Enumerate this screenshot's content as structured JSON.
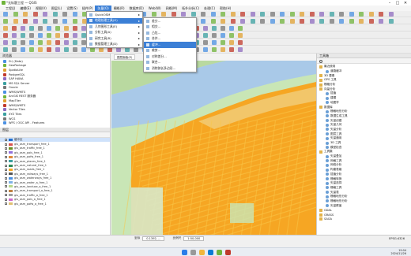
{
  "window": {
    "title": "*无标题工程 — QGIS",
    "controls": [
      "–",
      "□",
      "✕"
    ]
  },
  "menubar": {
    "items": [
      "工程(J)",
      "编辑(E)",
      "视图(V)",
      "图层(L)",
      "设置(S)",
      "插件(P)",
      "矢量(O)",
      "栅格(R)",
      "数据库(D)",
      "Web(W)",
      "网格(M)",
      "拓扑分析(C)",
      "处理(C)",
      "帮助(H)"
    ],
    "active_index": 6
  },
  "vector_menu": {
    "items": [
      {
        "label": "QuickOSM",
        "arrow": true
      },
      {
        "label": "地理处理工具(G)",
        "arrow": true,
        "highlighted": true
      },
      {
        "label": "几何图形工具(E)",
        "arrow": true
      },
      {
        "label": "分析工具(A)",
        "arrow": true
      },
      {
        "label": "研究工具(R)",
        "arrow": true
      },
      {
        "label": "数据管理工具(D)",
        "arrow": true
      }
    ]
  },
  "geoprocessing_submenu": {
    "items": [
      {
        "label": "差分...",
        "highlighted": false
      },
      {
        "label": "相交...",
        "highlighted": false
      },
      {
        "label": "凸包...",
        "highlighted": false
      },
      {
        "label": "合并...",
        "highlighted": false
      },
      {
        "label": "缓冲...",
        "highlighted": true
      },
      {
        "label": "裁剪...",
        "highlighted": false
      },
      {
        "label": "对称差分...",
        "highlighted": false
      },
      {
        "label": "联合...",
        "highlighted": false
      },
      {
        "label": "消除狭长多边形...",
        "highlighted": false
      }
    ]
  },
  "browser": {
    "title": "浏览器",
    "items": [
      "D:\\ (Data)",
      "GeoPackage",
      "SpatiaLite",
      "PostgreSQL",
      "SAP HANA",
      "MS SQL Server",
      "Oracle",
      "WMS/WMTS",
      "ArcGIS REST 服务器",
      "MapTiler",
      "WMS/WMTS",
      "Vector Tiles",
      "XYZ Tiles",
      "WCS",
      "WFS / OGC API - Features"
    ]
  },
  "layers": {
    "title": "图层",
    "items": [
      {
        "label": "缓冲区",
        "color": "#1f6fd1",
        "selected": true
      },
      {
        "label": "gis_osm_transport_free_1",
        "color": "#d9534f"
      },
      {
        "label": "gis_osm_traffic_free_1",
        "color": "#6b8e23"
      },
      {
        "label": "gis_osm_pois_free_1",
        "color": "#9370db"
      },
      {
        "label": "gis_osm_pofw_free_1",
        "color": "#e08a3c"
      },
      {
        "label": "gis_osm_places_free_1",
        "color": "#3aa0a0"
      },
      {
        "label": "gis_osm_natural_free_1",
        "color": "#2e8b57"
      },
      {
        "label": "gis_osm_roads_free_1",
        "color": "#f5a623"
      },
      {
        "label": "gis_osm_railways_free_1",
        "color": "#555555"
      },
      {
        "label": "gis_osm_waterways_free_1",
        "color": "#4a90e2"
      },
      {
        "label": "gis_osm_water_a_free_1",
        "color": "#7fb3e6"
      },
      {
        "label": "gis_osm_landuse_a_free_1",
        "color": "#b8d98a"
      },
      {
        "label": "gis_osm_transport_a_free_1",
        "color": "#c08040"
      },
      {
        "label": "gis_osm_traffic_a_free_1",
        "color": "#a0a0a0"
      },
      {
        "label": "gis_osm_pois_a_free_1",
        "color": "#cc66cc"
      },
      {
        "label": "gis_osm_pofw_a_free_1",
        "color": "#e0c070"
      }
    ]
  },
  "map": {
    "tabs": [
      "图层面板(E)",
      "图层/要素信息(I)"
    ],
    "water_color": "#a9c9e8",
    "land_color": "#c9e6b6",
    "buffer_color": "#f6a623",
    "road_color": "#f9c84a"
  },
  "toolbox": {
    "title": "工具箱",
    "items": [
      {
        "label": "最近使用",
        "level": 0,
        "icon": "clock-icon"
      },
      {
        "label": "道路缓冲",
        "level": 1
      },
      {
        "label": "3D 要素",
        "level": 0
      },
      {
        "label": "GPS 工具",
        "level": 0
      },
      {
        "label": "栅格分析",
        "level": 0
      },
      {
        "label": "向量分析",
        "level": 0
      },
      {
        "label": "插值",
        "level": 1
      },
      {
        "label": "建模",
        "level": 1
      },
      {
        "label": "地图学",
        "level": 1
      },
      {
        "label": "数据库",
        "level": 0
      },
      {
        "label": "栅格地形分析",
        "level": 1
      },
      {
        "label": "数据生成工具",
        "level": 1
      },
      {
        "label": "矢量创建",
        "level": 1
      },
      {
        "label": "矢量几何",
        "level": 1
      },
      {
        "label": "矢量分析",
        "level": 1
      },
      {
        "label": "图层工具",
        "level": 1
      },
      {
        "label": "矢量通用",
        "level": 1
      },
      {
        "label": "3D 工具",
        "level": 1
      },
      {
        "label": "模型检查",
        "level": 1
      },
      {
        "label": "工具集",
        "level": 0
      },
      {
        "label": "矢量叠加",
        "level": 1
      },
      {
        "label": "网格工具",
        "level": 1
      },
      {
        "label": "网络分析",
        "level": 1
      },
      {
        "label": "构建表格",
        "level": 1
      },
      {
        "label": "插值分析",
        "level": 1
      },
      {
        "label": "栅格转换",
        "level": 1
      },
      {
        "label": "矢量选择",
        "level": 1
      },
      {
        "label": "栅格工具",
        "level": 1
      },
      {
        "label": "矢量表",
        "level": 1
      },
      {
        "label": "栅格地形分析",
        "level": 1
      },
      {
        "label": "栅格地形分析",
        "level": 1
      },
      {
        "label": "矢量覆盖",
        "level": 1
      },
      {
        "label": "GDAL",
        "level": 0
      },
      {
        "label": "GRASS",
        "level": 0
      },
      {
        "label": "SAGA",
        "level": 0
      }
    ]
  },
  "statusbar": {
    "coord_label": "坐标",
    "coord_value": "0.1392, ...",
    "scale_label": "比例尺",
    "scale_value": "1:50,000",
    "crs": "EPSG:4326"
  },
  "taskbar": {
    "time": "19:04",
    "date": "2024/11/26"
  }
}
